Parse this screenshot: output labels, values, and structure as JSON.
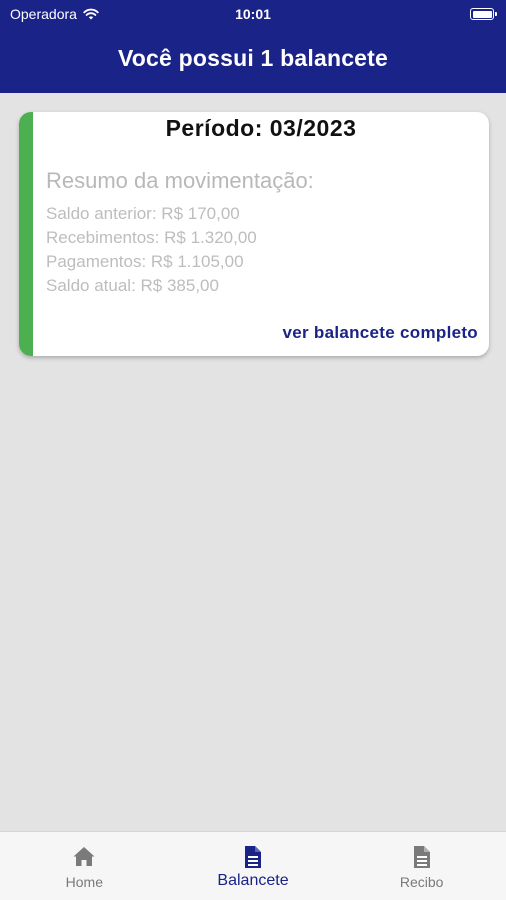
{
  "status_bar": {
    "carrier": "Operadora",
    "time": "10:01"
  },
  "header": {
    "title": "Você possui 1 balancete",
    "color": "#1a2387"
  },
  "card": {
    "accent_color": "#4caf50",
    "period": "Período: 03/2023",
    "summary_title": "Resumo da movimentação:",
    "lines": [
      "Saldo anterior: R$ 170,00",
      "Recebimentos: R$ 1.320,00",
      "Pagamentos: R$ 1.105,00",
      "Saldo atual: R$ 385,00"
    ],
    "link": "ver balancete completo"
  },
  "tabs": [
    {
      "label": "Home",
      "icon": "home-icon"
    },
    {
      "label": "Balancete",
      "icon": "document-icon",
      "active": true
    },
    {
      "label": "Recibo",
      "icon": "document-icon"
    }
  ]
}
